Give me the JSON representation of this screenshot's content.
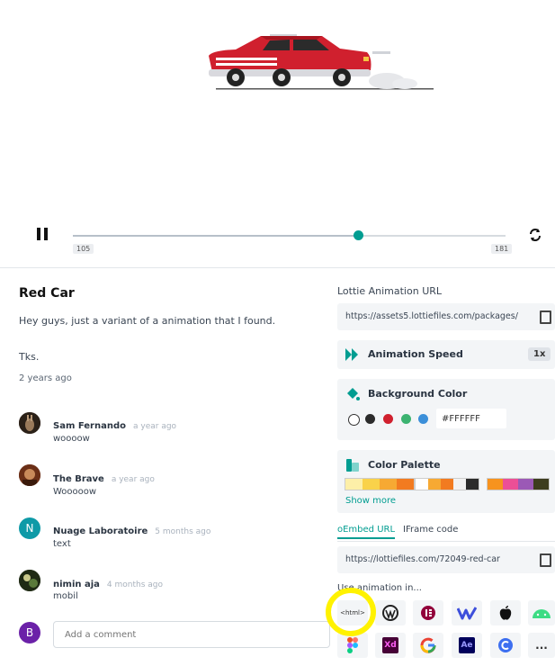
{
  "player": {
    "frame_start": "105",
    "frame_end": "181",
    "progress": 0.66
  },
  "animation": {
    "title": "Red Car",
    "description": "Hey guys, just a variant of a animation that I found.",
    "description2": "Tks.",
    "posted": "2 years ago"
  },
  "comments": [
    {
      "name": "Sam Fernando",
      "time": "a year ago",
      "text": "woooow"
    },
    {
      "name": "The Brave",
      "time": "a year ago",
      "text": "Wooooow"
    },
    {
      "name": "Nuage Laboratoire",
      "time": "5 months ago",
      "text": "text",
      "initial": "N"
    },
    {
      "name": "nimin aja",
      "time": "4 months ago",
      "text": "mobil"
    }
  ],
  "add_comment": {
    "initial": "B",
    "placeholder": "Add a comment"
  },
  "side": {
    "url_label": "Lottie Animation URL",
    "url_value": "https://assets5.lottiefiles.com/packages/",
    "speed_label": "Animation Speed",
    "speed_value": "1x",
    "bg_label": "Background Color",
    "bg_value": "#FFFFFF",
    "palette_label": "Color Palette",
    "show_more": "Show more",
    "tab_oembed": "oEmbed URL",
    "tab_iframe": "IFrame code",
    "embed_value": "https://lottiefiles.com/72049-red-car",
    "use_in_label": "Use animation in...",
    "html_tag": "<html>",
    "xd_label": "Xd",
    "ae_label": "Ae",
    "more_label": "..."
  },
  "colors": {
    "accent": "#019d91",
    "car_red": "#d0202e",
    "highlight": "#fff200",
    "bg_swatches": [
      "#ffffff",
      "#2b2b2b",
      "#d0202e",
      "#3cb371",
      "#3b8fd9"
    ],
    "palette_group1": [
      "#fdefa8",
      "#f9d24a",
      "#f7a933",
      "#f27b20"
    ],
    "palette_group2": [
      "#ffffff",
      "#f7a933",
      "#f27b20",
      "#f2f2f2",
      "#2b2b2b"
    ],
    "palette_group3": [
      "#f7931e",
      "#ec4f96",
      "#9b59b6",
      "#3d3d1f"
    ]
  }
}
